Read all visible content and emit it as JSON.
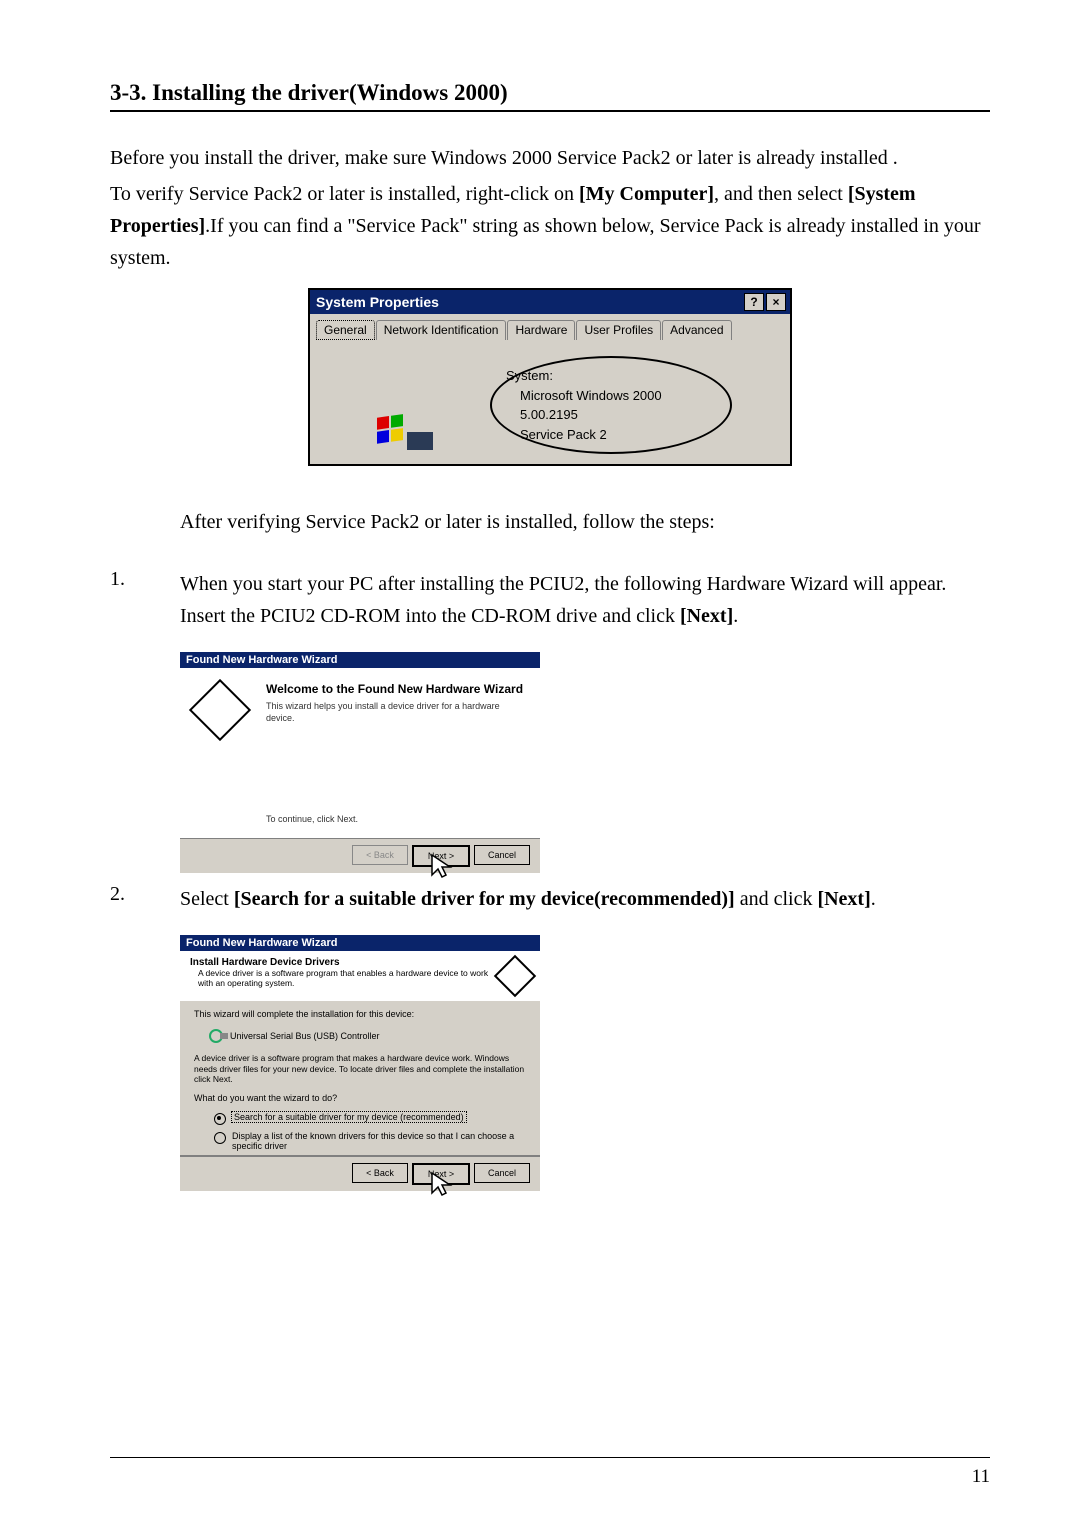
{
  "heading": "3-3. Installing the driver(Windows 2000)",
  "intro": {
    "line1a": "Before you install the driver, make sure Windows 2000 Service Pack2 or later is already installed .",
    "line2a": "To verify Service Pack2 or later is installed, right-click on ",
    "mycomputer": "[My Computer]",
    "line2b": ", and then select ",
    "sysprop": "[System Properties]",
    "line2c": ".If you can find a \"Service Pack\" string as shown below, Service Pack is already installed in your system."
  },
  "system_properties": {
    "title": "System Properties",
    "help_btn": "?",
    "close_btn": "×",
    "tabs": [
      "General",
      "Network Identification",
      "Hardware",
      "User Profiles",
      "Advanced"
    ],
    "section_label": "System:",
    "os_name": "Microsoft Windows 2000",
    "version": "5.00.2195",
    "service_pack": "Service Pack 2"
  },
  "after_verify": "After verifying Service Pack2 or later is installed, follow the steps:",
  "step1": {
    "num": "1.",
    "text_a": "When you start your PC after installing the PCIU2, the following Hardware Wizard will appear. Insert the PCIU2 CD-ROM into the CD-ROM drive and click ",
    "next": "[Next]",
    "text_b": "."
  },
  "wizard1": {
    "title": "Found New Hardware Wizard",
    "heading": "Welcome to the Found New Hardware Wizard",
    "desc": "This wizard helps you install a device driver for a hardware device.",
    "continue": "To continue, click Next.",
    "back": "< Back",
    "next": "Next >",
    "cancel": "Cancel"
  },
  "step2": {
    "num": "2.",
    "text_a": "Select ",
    "search": "[Search for a suitable driver for my device(recommended)]",
    "text_b": " and click ",
    "next": "[Next]",
    "text_c": "."
  },
  "wizard2": {
    "title": "Found New Hardware Wizard",
    "heading": "Install Hardware Device Drivers",
    "sub": "A device driver is a software program that enables a hardware device to work with an operating system.",
    "line1": "This wizard will complete the installation for this device:",
    "device": "Universal Serial Bus (USB) Controller",
    "desc2": "A device driver is a software program that makes a hardware device work. Windows needs driver files for your new device. To locate driver files and complete the installation click Next.",
    "question": "What do you want the wizard to do?",
    "opt1": "Search for a suitable driver for my device (recommended)",
    "opt2": "Display a list of the known drivers for this device so that I can choose a specific driver",
    "back": "< Back",
    "next": "Next >",
    "cancel": "Cancel"
  },
  "pagenum": "11"
}
